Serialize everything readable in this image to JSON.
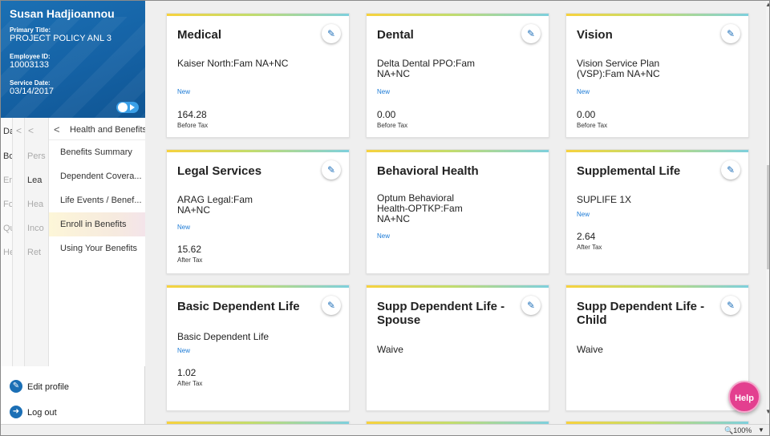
{
  "profile": {
    "name": "Susan Hadjioannou",
    "primary_title_label": "Primary Title:",
    "primary_title": "PROJECT POLICY ANL 3",
    "employee_id_label": "Employee ID:",
    "employee_id": "10003133",
    "service_date_label": "Service Date:",
    "service_date": "03/14/2017"
  },
  "nav": {
    "col_a": [
      "Das",
      "Boo",
      "Emp",
      "For",
      "Qui",
      "Hel"
    ],
    "col_b_chevron": "<",
    "col_c": [
      "Pers",
      "Lea",
      "Hea",
      "Inco",
      "Ret"
    ],
    "header": "Health and Benefits",
    "items": [
      {
        "label": "Benefits Summary"
      },
      {
        "label": "Dependent Covera..."
      },
      {
        "label": "Life Events / Benef..."
      },
      {
        "label": "Enroll in Benefits"
      },
      {
        "label": "Using Your Benefits"
      }
    ]
  },
  "actions": {
    "edit_profile": "Edit profile",
    "log_out": "Log out"
  },
  "cards": [
    {
      "title": "Medical",
      "plan": "Kaiser North:Fam NA+NC",
      "status": "New",
      "amount": "164.28",
      "tax": "Before Tax"
    },
    {
      "title": "Dental",
      "plan": "Delta Dental PPO:Fam NA+NC",
      "status": "New",
      "amount": "0.00",
      "tax": "Before Tax"
    },
    {
      "title": "Vision",
      "plan": "Vision Service Plan (VSP):Fam NA+NC",
      "status": "New",
      "amount": "0.00",
      "tax": "Before Tax"
    },
    {
      "title": "Legal Services",
      "plan": "ARAG Legal:Fam NA+NC",
      "status": "New",
      "amount": "15.62",
      "tax": "After Tax"
    },
    {
      "title": "Behavioral Health",
      "plan": "Optum Behavioral Health-OPTKP:Fam NA+NC",
      "status": "New",
      "amount": "",
      "tax": ""
    },
    {
      "title": "Supplemental Life",
      "plan": "SUPLIFE 1X",
      "status": "New",
      "amount": "2.64",
      "tax": "After Tax"
    },
    {
      "title": "Basic Dependent Life",
      "plan": "Basic Dependent Life",
      "status": "New",
      "amount": "1.02",
      "tax": "After Tax"
    },
    {
      "title": "Supp Dependent Life - Spouse",
      "plan": "Waive",
      "status": "",
      "amount": "",
      "tax": ""
    },
    {
      "title": "Supp Dependent Life - Child",
      "plan": "Waive",
      "status": "",
      "amount": "",
      "tax": ""
    }
  ],
  "help_label": "Help",
  "statusbar": {
    "zoom": "100%"
  },
  "icons": {
    "edit": "pencil-icon",
    "toggle": "toggle-icon",
    "help": "help-icon"
  },
  "colors": {
    "brand_blue": "#1562a5",
    "active_item": "#fdf6d8",
    "help": "#e33f8f",
    "status_link": "#1b7ad6"
  }
}
